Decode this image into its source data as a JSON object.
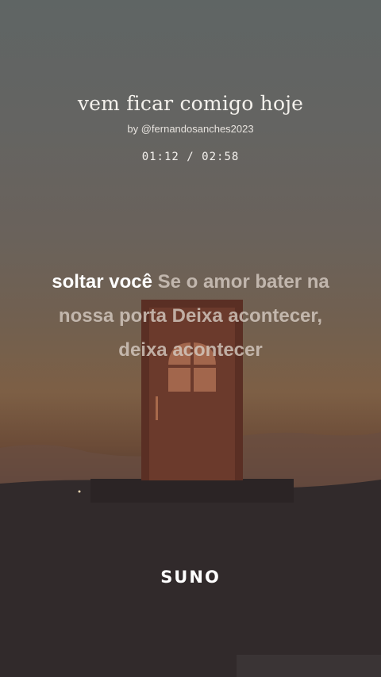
{
  "song": {
    "title": "vem ficar comigo hoje",
    "author": "by @fernandosanches2023"
  },
  "player": {
    "current_time": "01:12",
    "separator": "/",
    "duration": "02:58"
  },
  "lyrics": {
    "sung": "soltar você",
    "upcoming": "Se o amor bater na nossa porta Deixa acontecer, deixa acontecer"
  },
  "brand": {
    "logo_text": "SUNO"
  },
  "colors": {
    "lyric_active": "#ffffff",
    "lyric_inactive": "#d9cfc6",
    "door": "#6b3a2c",
    "door_frame": "#5a2f24"
  }
}
